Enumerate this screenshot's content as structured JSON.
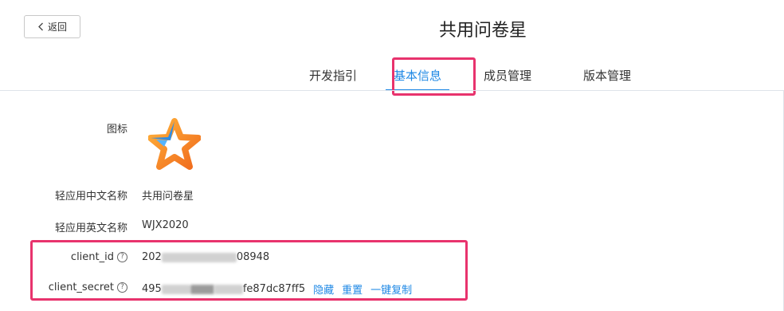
{
  "header": {
    "back_label": "返回",
    "title": "共用问卷星"
  },
  "tabs": [
    {
      "label": "开发指引",
      "active": false
    },
    {
      "label": "基本信息",
      "active": true
    },
    {
      "label": "成员管理",
      "active": false
    },
    {
      "label": "版本管理",
      "active": false
    }
  ],
  "info": {
    "icon_label": "图标",
    "cn_name_label": "轻应用中文名称",
    "cn_name_value": "共用问卷星",
    "en_name_label": "轻应用英文名称",
    "en_name_value": "WJX2020",
    "client_id_label": "client_id",
    "client_id_value_start": "202",
    "client_id_value_end": "08948",
    "client_secret_label": "client_secret",
    "client_secret_value_start": "495",
    "client_secret_value_end": "fe87dc87ff5",
    "hide_label": "隐藏",
    "reset_label": "重置",
    "copy_label": "一键复制",
    "help_glyph": "?"
  },
  "colors": {
    "accent": "#1e88e5",
    "highlight": "#e8336d"
  }
}
